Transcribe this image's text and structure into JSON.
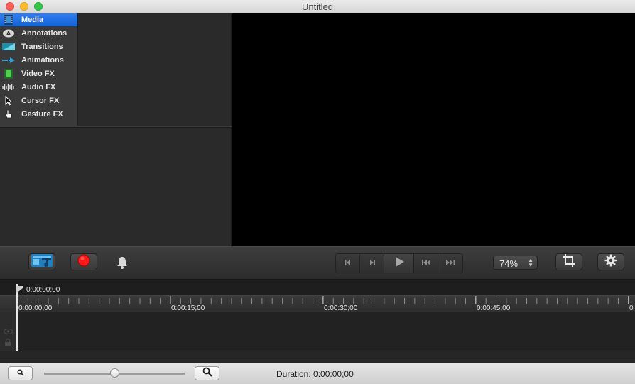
{
  "window": {
    "title": "Untitled"
  },
  "sidebar": {
    "items": [
      {
        "label": "Media",
        "icon": "film-strip-icon",
        "active": true
      },
      {
        "label": "Annotations",
        "icon": "annotation-icon",
        "active": false
      },
      {
        "label": "Transitions",
        "icon": "transition-icon",
        "active": false
      },
      {
        "label": "Animations",
        "icon": "animation-arrow-icon",
        "active": false
      },
      {
        "label": "Video FX",
        "icon": "video-fx-icon",
        "active": false
      },
      {
        "label": "Audio FX",
        "icon": "waveform-icon",
        "active": false
      },
      {
        "label": "Cursor FX",
        "icon": "cursor-icon",
        "active": false
      },
      {
        "label": "Gesture FX",
        "icon": "hand-pointer-icon",
        "active": false
      }
    ]
  },
  "toolbar": {
    "media_button_icon": "media-import-icon",
    "record_button_icon": "record-icon",
    "notification_icon": "bell-icon",
    "transport": [
      "step-back-icon",
      "step-forward-icon",
      "play-icon",
      "skip-to-start-icon",
      "skip-to-end-icon"
    ],
    "zoom_level": "74%",
    "crop_icon": "crop-icon",
    "settings_icon": "gear-icon"
  },
  "timeline": {
    "playhead_time": "0:00:00;00",
    "ruler_labels": [
      "0:00:00;00",
      "0:00:15;00",
      "0:00:30;00",
      "0:00:45;00",
      "0"
    ],
    "track_controls": [
      "eye-icon",
      "lock-icon"
    ]
  },
  "bottombar": {
    "zoom_out_icon": "magnifier-small-icon",
    "zoom_in_icon": "magnifier-large-icon",
    "zoom_slider_value": 0.5,
    "duration_text": "Duration: 0:00:00;00"
  },
  "colors": {
    "accent": "#1a6be0",
    "record": "#ff1a1a",
    "canvas": "#000000",
    "media_icon": "#2b9bd8"
  }
}
